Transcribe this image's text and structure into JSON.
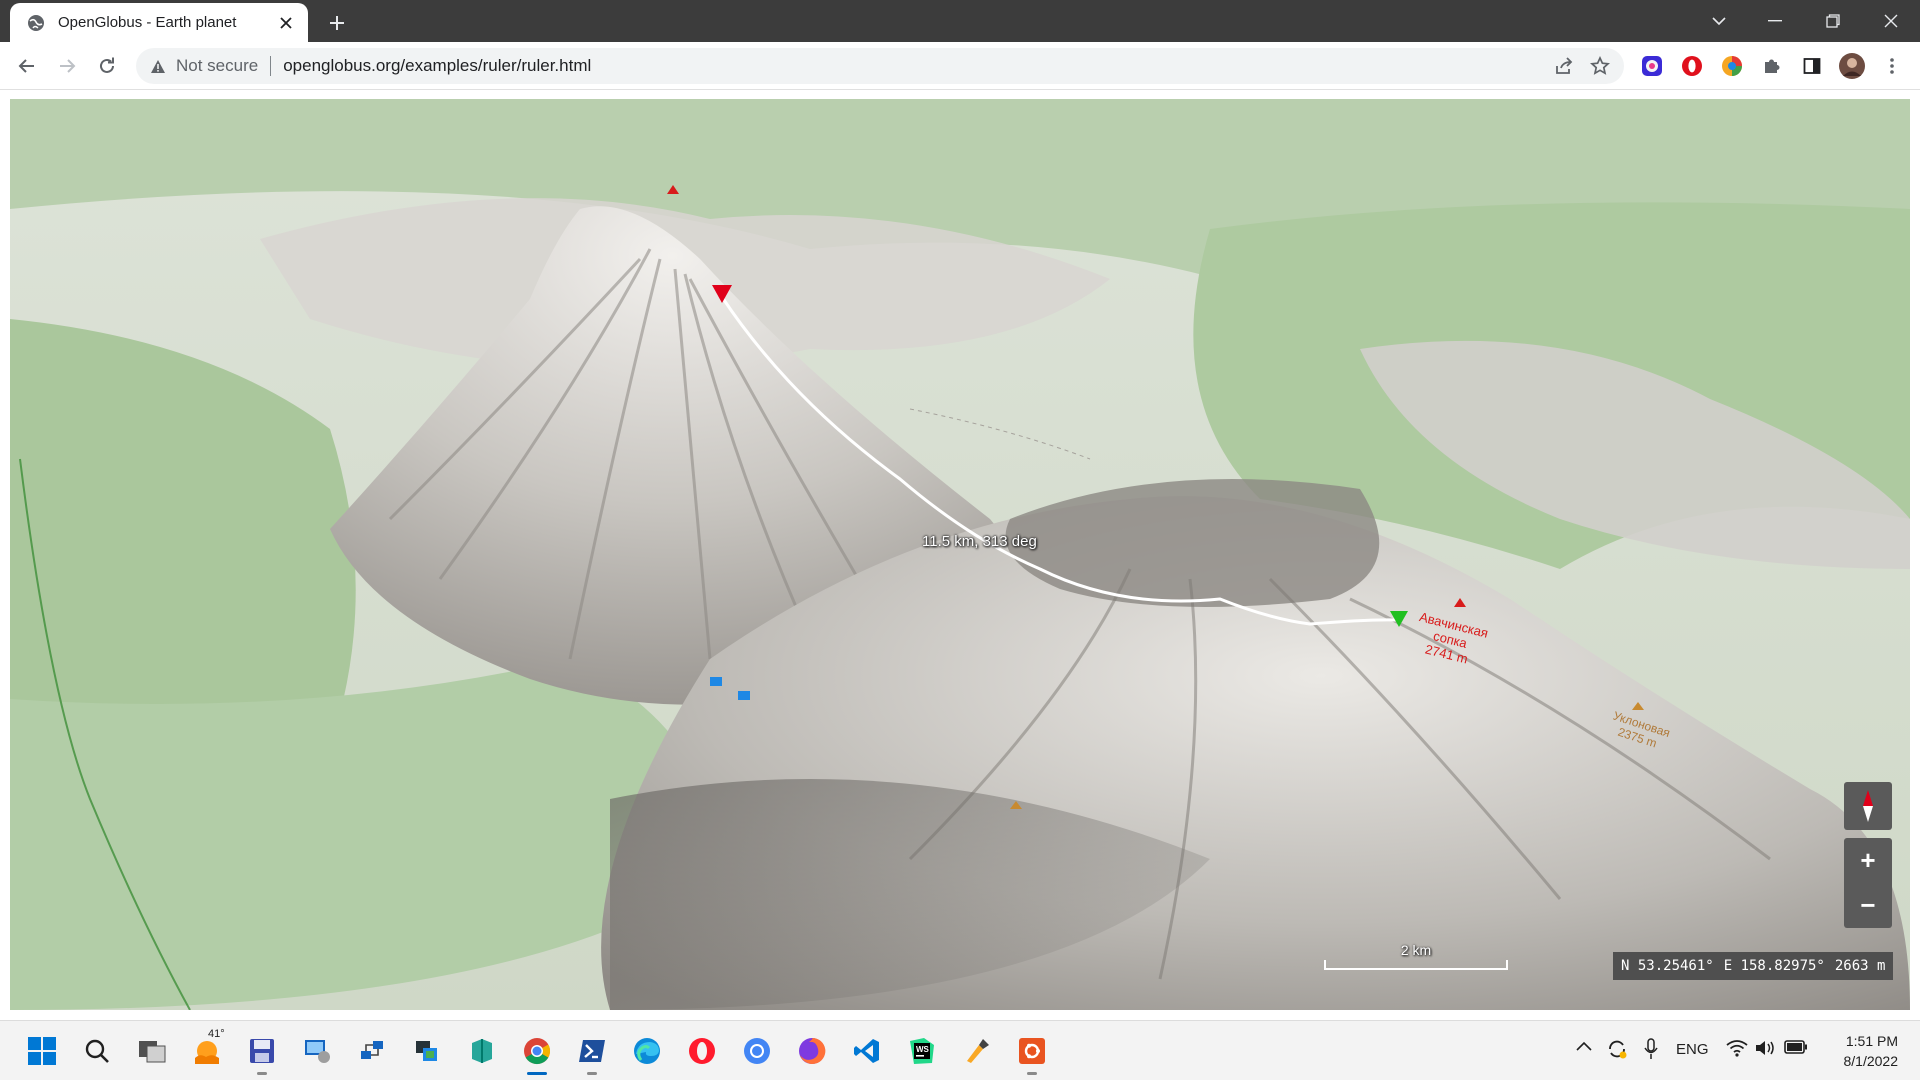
{
  "browser": {
    "tab_title": "OpenGlobus - Earth planet",
    "favicon": "globe-icon",
    "security_label": "Not secure",
    "url": "openglobus.org/examples/ruler/ruler.html"
  },
  "map": {
    "measurement_label": "11.5 km, 313 deg",
    "peak_labels": {
      "avachinskaya_line1": "Авачинская",
      "avachinskaya_line2": "сопка",
      "avachinskaya_line3": "2741 m",
      "uklovaya_line1": "Уклоновая",
      "uklovaya_line2": "2375 m"
    },
    "scale_label": "2 km",
    "coords": {
      "lat": "N 53.25461°",
      "lon": "E 158.82975°",
      "height": "2663 m"
    },
    "controls": {
      "compass": "compass-icon",
      "zoom_in": "+",
      "zoom_out": "−"
    },
    "colors": {
      "route": "#ffffff",
      "start_marker": "#e0001a",
      "end_marker": "#20c020",
      "peak_label": "#d81b1b"
    }
  },
  "taskbar": {
    "weather_temp": "41°",
    "language": "ENG",
    "time": "1:51 PM",
    "date": "8/1/2022",
    "apps": [
      "start-icon",
      "search-icon",
      "task-view-icon",
      "weather-icon",
      "save-disk-icon",
      "remote-desktop-icon",
      "network-icon",
      "storage-icon",
      "s3-browser-icon",
      "chrome-icon",
      "powershell-icon",
      "edge-icon",
      "opera-icon",
      "chrome-alt-icon",
      "firefox-icon",
      "vscode-icon",
      "webstorm-icon",
      "tool-icon",
      "ubuntu-icon"
    ]
  }
}
